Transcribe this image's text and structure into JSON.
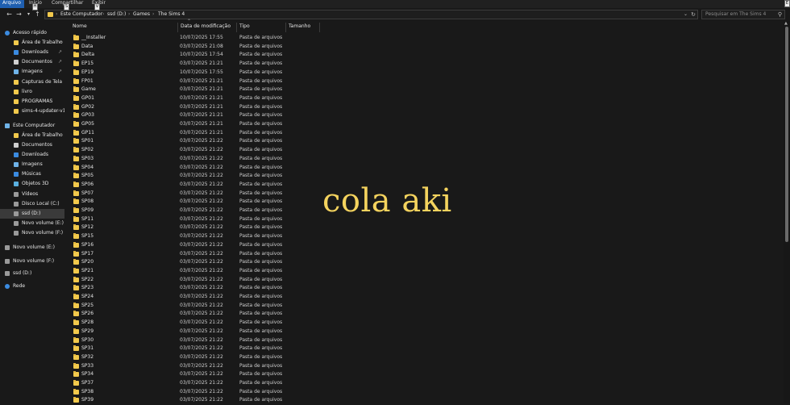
{
  "ribbon": {
    "tabs": [
      "Arquivo",
      "Início",
      "Compartilhar",
      "Exibir"
    ],
    "keytips": [
      "H",
      "S",
      "V",
      "E"
    ]
  },
  "address": {
    "crumbs": [
      "Este Computador",
      "ssd (D:)",
      "Games",
      "The Sims 4"
    ]
  },
  "search": {
    "placeholder": "Pesquisar em The Sims 4"
  },
  "nav": {
    "items": [
      {
        "label": "Acesso rápido",
        "icon": "star-icon",
        "pinned": false
      },
      {
        "label": "Área de Trabalho",
        "icon": "folder-icon",
        "pinned": true
      },
      {
        "label": "Downloads",
        "icon": "download-icon",
        "pinned": true
      },
      {
        "label": "Documentos",
        "icon": "document-icon",
        "pinned": true
      },
      {
        "label": "Imagens",
        "icon": "image-icon",
        "pinned": true
      },
      {
        "label": "Capturas de Tela",
        "icon": "folder-icon",
        "pinned": false
      },
      {
        "label": "livro",
        "icon": "folder-icon",
        "pinned": false
      },
      {
        "label": "PROGRAMAS",
        "icon": "folder-icon",
        "pinned": false
      },
      {
        "label": "sims-4-updater-v1.4",
        "icon": "folder-icon",
        "pinned": false
      },
      {
        "label": "Este Computador",
        "icon": "computer-icon",
        "pinned": false
      },
      {
        "label": "Área de Trabalho",
        "icon": "folder-icon",
        "pinned": false
      },
      {
        "label": "Documentos",
        "icon": "document-icon",
        "pinned": false
      },
      {
        "label": "Downloads",
        "icon": "download-icon",
        "pinned": false
      },
      {
        "label": "Imagens",
        "icon": "image-icon",
        "pinned": false
      },
      {
        "label": "Músicas",
        "icon": "music-icon",
        "pinned": false
      },
      {
        "label": "Objetos 3D",
        "icon": "cube-icon",
        "pinned": false
      },
      {
        "label": "Vídeos",
        "icon": "video-icon",
        "pinned": false
      },
      {
        "label": "Disco Local (C:)",
        "icon": "drive-icon",
        "pinned": false
      },
      {
        "label": "ssd (D:)",
        "icon": "drive-icon",
        "pinned": false
      },
      {
        "label": "Novo volume (E:)",
        "icon": "drive-icon",
        "pinned": false
      },
      {
        "label": "Novo volume (F:)",
        "icon": "drive-icon",
        "pinned": false
      },
      {
        "label": "Novo volume (E:)",
        "icon": "drive-icon",
        "pinned": false
      },
      {
        "label": "Novo volume (F:)",
        "icon": "drive-icon",
        "pinned": false
      },
      {
        "label": "ssd (D:)",
        "icon": "drive-icon",
        "pinned": false
      },
      {
        "label": "Rede",
        "icon": "network-icon",
        "pinned": false
      }
    ]
  },
  "columns": {
    "name": "Nome",
    "date": "Data de modificação",
    "type": "Tipo",
    "size": "Tamanho"
  },
  "files": [
    {
      "name": "__Installer",
      "date": "10/07/2025 17:55",
      "type": "Pasta de arquivos"
    },
    {
      "name": "Data",
      "date": "03/07/2025 21:08",
      "type": "Pasta de arquivos"
    },
    {
      "name": "Delta",
      "date": "10/07/2025 17:54",
      "type": "Pasta de arquivos"
    },
    {
      "name": "EP15",
      "date": "03/07/2025 21:21",
      "type": "Pasta de arquivos"
    },
    {
      "name": "EP19",
      "date": "10/07/2025 17:55",
      "type": "Pasta de arquivos"
    },
    {
      "name": "FP01",
      "date": "03/07/2025 21:21",
      "type": "Pasta de arquivos"
    },
    {
      "name": "Game",
      "date": "03/07/2025 21:21",
      "type": "Pasta de arquivos"
    },
    {
      "name": "GP01",
      "date": "03/07/2025 21:21",
      "type": "Pasta de arquivos"
    },
    {
      "name": "GP02",
      "date": "03/07/2025 21:21",
      "type": "Pasta de arquivos"
    },
    {
      "name": "GP03",
      "date": "03/07/2025 21:21",
      "type": "Pasta de arquivos"
    },
    {
      "name": "GP05",
      "date": "03/07/2025 21:21",
      "type": "Pasta de arquivos"
    },
    {
      "name": "GP11",
      "date": "03/07/2025 21:21",
      "type": "Pasta de arquivos"
    },
    {
      "name": "SP01",
      "date": "03/07/2025 21:22",
      "type": "Pasta de arquivos"
    },
    {
      "name": "SP02",
      "date": "03/07/2025 21:22",
      "type": "Pasta de arquivos"
    },
    {
      "name": "SP03",
      "date": "03/07/2025 21:22",
      "type": "Pasta de arquivos"
    },
    {
      "name": "SP04",
      "date": "03/07/2025 21:22",
      "type": "Pasta de arquivos"
    },
    {
      "name": "SP05",
      "date": "03/07/2025 21:22",
      "type": "Pasta de arquivos"
    },
    {
      "name": "SP06",
      "date": "03/07/2025 21:22",
      "type": "Pasta de arquivos"
    },
    {
      "name": "SP07",
      "date": "03/07/2025 21:22",
      "type": "Pasta de arquivos"
    },
    {
      "name": "SP08",
      "date": "03/07/2025 21:22",
      "type": "Pasta de arquivos"
    },
    {
      "name": "SP09",
      "date": "03/07/2025 21:22",
      "type": "Pasta de arquivos"
    },
    {
      "name": "SP11",
      "date": "03/07/2025 21:22",
      "type": "Pasta de arquivos"
    },
    {
      "name": "SP12",
      "date": "03/07/2025 21:22",
      "type": "Pasta de arquivos"
    },
    {
      "name": "SP15",
      "date": "03/07/2025 21:22",
      "type": "Pasta de arquivos"
    },
    {
      "name": "SP16",
      "date": "03/07/2025 21:22",
      "type": "Pasta de arquivos"
    },
    {
      "name": "SP17",
      "date": "03/07/2025 21:22",
      "type": "Pasta de arquivos"
    },
    {
      "name": "SP20",
      "date": "03/07/2025 21:22",
      "type": "Pasta de arquivos"
    },
    {
      "name": "SP21",
      "date": "03/07/2025 21:22",
      "type": "Pasta de arquivos"
    },
    {
      "name": "SP22",
      "date": "03/07/2025 21:22",
      "type": "Pasta de arquivos"
    },
    {
      "name": "SP23",
      "date": "03/07/2025 21:22",
      "type": "Pasta de arquivos"
    },
    {
      "name": "SP24",
      "date": "03/07/2025 21:22",
      "type": "Pasta de arquivos"
    },
    {
      "name": "SP25",
      "date": "03/07/2025 21:22",
      "type": "Pasta de arquivos"
    },
    {
      "name": "SP26",
      "date": "03/07/2025 21:22",
      "type": "Pasta de arquivos"
    },
    {
      "name": "SP28",
      "date": "03/07/2025 21:22",
      "type": "Pasta de arquivos"
    },
    {
      "name": "SP29",
      "date": "03/07/2025 21:22",
      "type": "Pasta de arquivos"
    },
    {
      "name": "SP30",
      "date": "03/07/2025 21:22",
      "type": "Pasta de arquivos"
    },
    {
      "name": "SP31",
      "date": "03/07/2025 21:22",
      "type": "Pasta de arquivos"
    },
    {
      "name": "SP32",
      "date": "03/07/2025 21:22",
      "type": "Pasta de arquivos"
    },
    {
      "name": "SP33",
      "date": "03/07/2025 21:22",
      "type": "Pasta de arquivos"
    },
    {
      "name": "SP34",
      "date": "03/07/2025 21:22",
      "type": "Pasta de arquivos"
    },
    {
      "name": "SP37",
      "date": "03/07/2025 21:22",
      "type": "Pasta de arquivos"
    },
    {
      "name": "SP38",
      "date": "03/07/2025 21:22",
      "type": "Pasta de arquivos"
    },
    {
      "name": "SP39",
      "date": "03/07/2025 21:22",
      "type": "Pasta de arquivos"
    }
  ],
  "overlay_text": "cola aki",
  "colors": {
    "folder": "#f2c94c",
    "overlay": "#f4d35e",
    "background": "#191919",
    "accent": "#1f5fb0"
  }
}
